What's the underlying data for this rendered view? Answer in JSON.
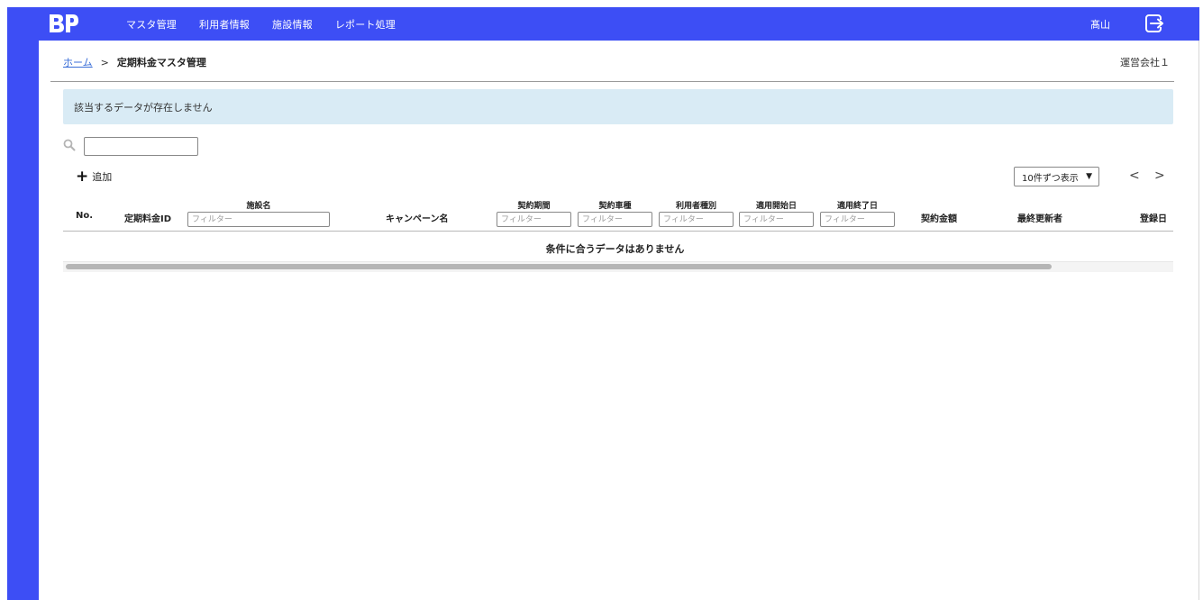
{
  "header": {
    "logo_text": "BP",
    "nav": [
      "マスタ管理",
      "利用者情報",
      "施設情報",
      "レポート処理"
    ],
    "user_name": "髙山",
    "brand_color": "#3d4ef5"
  },
  "breadcrumb": {
    "home": "ホーム",
    "separator": ">",
    "current": "定期料金マスタ管理"
  },
  "company": "運営会社１",
  "alert": {
    "message": "該当するデータが存在しません",
    "color": "#d9ebf5"
  },
  "search": {
    "value": "",
    "icon": "search-icon"
  },
  "toolbar": {
    "add_label": "追加",
    "page_size": "10件ずつ表示",
    "prev": "<",
    "next": ">"
  },
  "table": {
    "columns": {
      "no": "No.",
      "plan_id": "定期料金ID",
      "facility": "施設名",
      "campaign": "キャンペーン名",
      "contract_period": "契約期間",
      "vehicle_type": "契約車種",
      "user_type": "利用者種別",
      "start_date": "適用開始日",
      "end_date": "適用終了日",
      "amount": "契約金額",
      "updated_by": "最終更新者",
      "registered": "登録日"
    },
    "filter_placeholder": "フィルター",
    "empty_message": "条件に合うデータはありません"
  }
}
